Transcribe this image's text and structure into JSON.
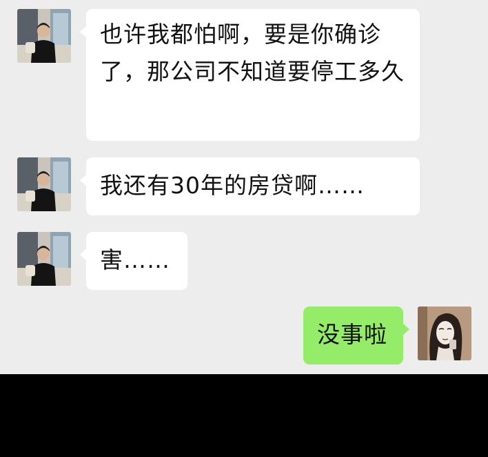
{
  "messages": [
    {
      "sender": "other",
      "avatar": "man-in-black-shirt-avatar",
      "text": "也许我都怕啊，要是你确诊了，那公司不知道要停工多久"
    },
    {
      "sender": "other",
      "avatar": "man-in-black-shirt-avatar",
      "text": "我还有30年的房贷啊……"
    },
    {
      "sender": "other",
      "avatar": "man-in-black-shirt-avatar",
      "text": "害……"
    },
    {
      "sender": "self",
      "avatar": "illustrated-woman-avatar",
      "text": "没事啦"
    }
  ],
  "colors": {
    "chat_background": "#ededed",
    "incoming_bubble": "#ffffff",
    "outgoing_bubble": "#95ec69",
    "bottom_bar": "#000000"
  }
}
